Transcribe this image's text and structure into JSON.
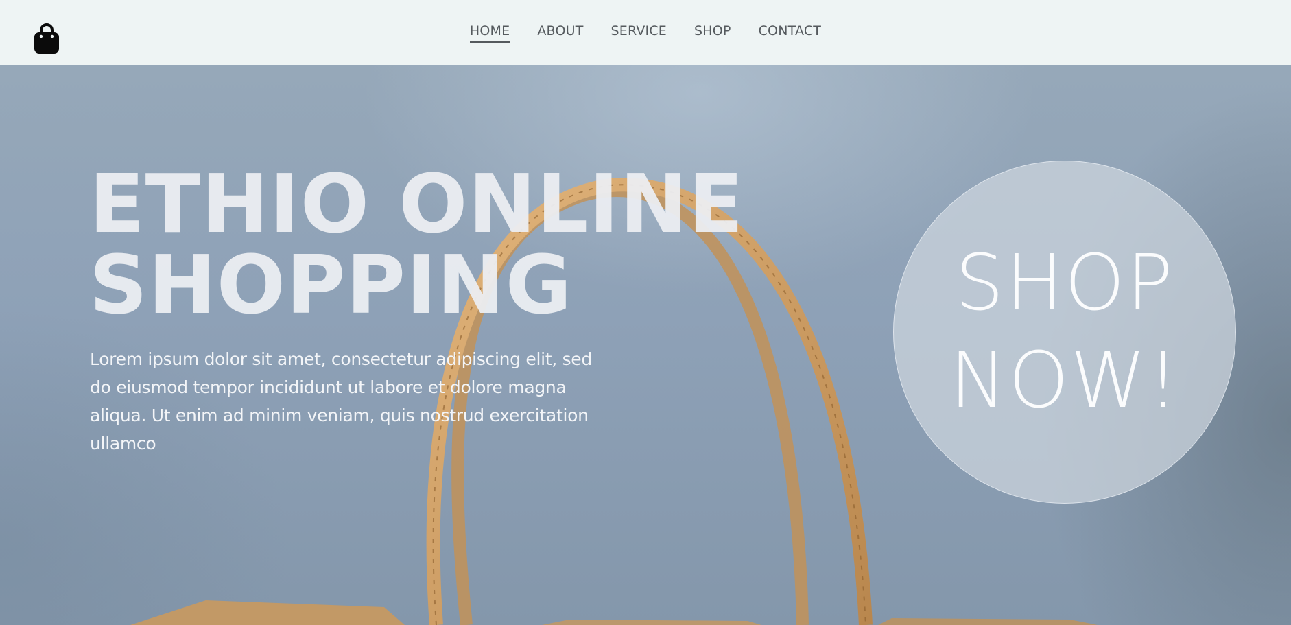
{
  "header": {
    "logo_icon": "shopping-bag-icon",
    "nav": [
      {
        "label": "HOME",
        "active": true
      },
      {
        "label": "ABOUT",
        "active": false
      },
      {
        "label": "SERVICE",
        "active": false
      },
      {
        "label": "SHOP",
        "active": false
      },
      {
        "label": "CONTACT",
        "active": false
      }
    ]
  },
  "hero": {
    "headline_line1": "ETHIO ONLINE",
    "headline_line2": "SHOPPING",
    "lead": "Lorem ipsum dolor sit amet, consectetur adipiscing elit, sed do eiusmod tempor incididunt ut labore et dolore magna aliqua. Ut enim ad minim veniam, quis nostrud exercitation ullamco",
    "cta_line1": "SHOP",
    "cta_line2": "NOW!"
  },
  "colors": {
    "header_bg": "#eef4f4",
    "nav_text": "#555a5e",
    "hero_bg": "#8fa3b8",
    "bag_kraft": "#c9995e"
  }
}
